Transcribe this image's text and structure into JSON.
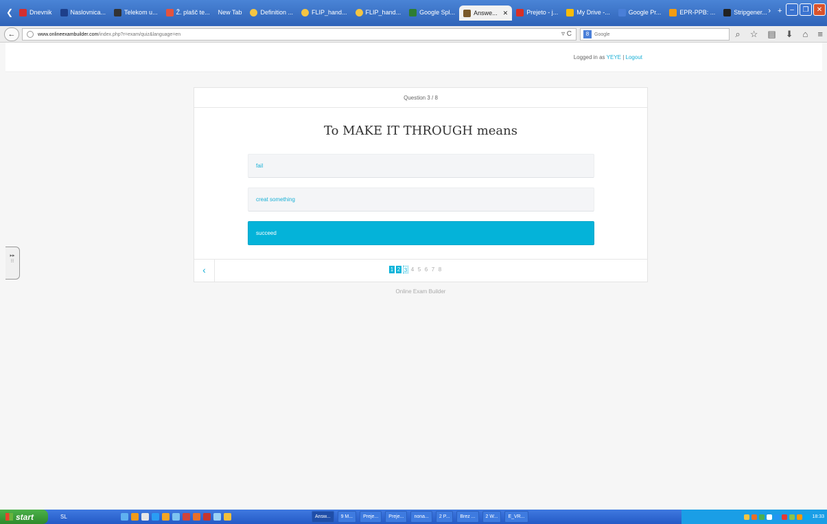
{
  "browser": {
    "tabs": [
      {
        "label": "Dnevnik",
        "color": "#d32f2f"
      },
      {
        "label": "Naslovnica...",
        "color": "#1e3f8a"
      },
      {
        "label": "Telekom u...",
        "color": "#333333"
      },
      {
        "label": "Ž. plašč te...",
        "color": "#e5533d"
      },
      {
        "label": "New Tab",
        "color": ""
      },
      {
        "label": "Definition ...",
        "color": "#f5c542"
      },
      {
        "label": "FLIP_hand...",
        "color": "#f5c542"
      },
      {
        "label": "FLIP_hand...",
        "color": "#f5c542"
      },
      {
        "label": "Google Spl...",
        "color": "#2e7d32"
      },
      {
        "label": "Answe...",
        "color": "#7a5a2a",
        "active": true
      },
      {
        "label": "Prejeto - j...",
        "color": "#d93025"
      },
      {
        "label": "My Drive -...",
        "color": "#fbbc05"
      },
      {
        "label": "Google Pr...",
        "color": "#4a7fd8"
      },
      {
        "label": "EPR-PPB: ...",
        "color": "#f39c12"
      },
      {
        "label": "Stripgener...",
        "color": "#222222"
      }
    ],
    "url_host": "www.onlineexambuilder.com",
    "url_path": "/index.php?r=exam/quiz&language=en",
    "search_placeholder": "Google"
  },
  "header": {
    "logged_in_prefix": "Logged in as",
    "username": "YEYE",
    "separator": "|",
    "logout": "Logout"
  },
  "quiz": {
    "progress": "Question 3 / 8",
    "question": "To MAKE IT THROUGH means",
    "answers": [
      {
        "text": "fail",
        "selected": false
      },
      {
        "text": "creat something",
        "selected": false
      },
      {
        "text": "succeed",
        "selected": true
      }
    ],
    "prev_symbol": "‹",
    "pages": [
      "1",
      "2",
      "3",
      "4",
      "5",
      "6",
      "7",
      "8"
    ],
    "answered_pages": [
      1,
      2
    ],
    "current_page": 3
  },
  "footer": {
    "text": "Online Exam Builder"
  },
  "taskbar": {
    "start": "start",
    "lang": "SL",
    "apps": [
      "Answ...",
      "9 M...",
      "Preje...",
      "Preje...",
      "nona...",
      "2 P...",
      "Brez ...",
      "2 W...",
      "E_VR..."
    ],
    "clock": "18:33"
  }
}
